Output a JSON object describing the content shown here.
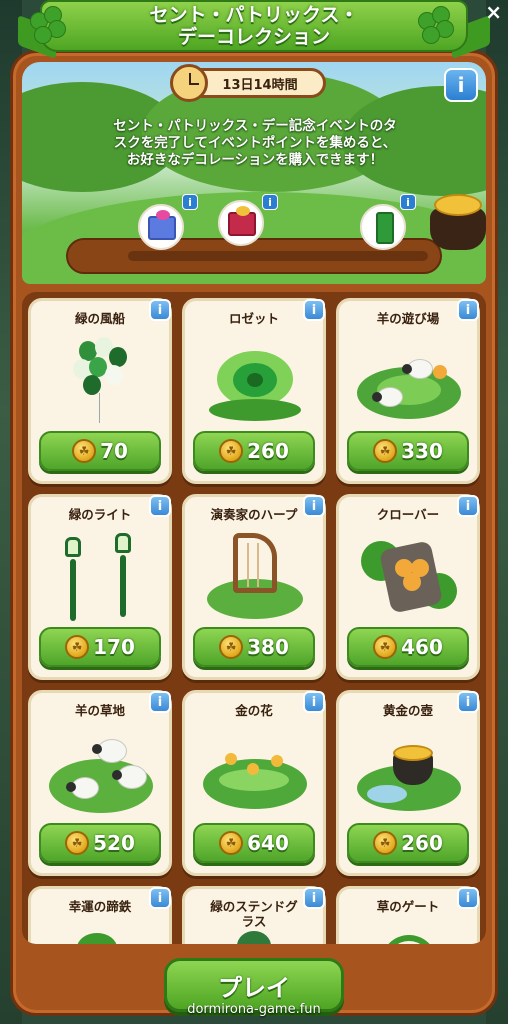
{
  "window": {
    "title": "セント・パトリックス・\nデーコレクション",
    "close_glyph": "×"
  },
  "event": {
    "timer": "13日14時間",
    "description": "セント・パトリックス・デー記念イベントのタ\nスクを完了してイベントポイントを集めると、\nお好きなデコレーションを購入できます！",
    "info_glyph": "i"
  },
  "rewards": [
    {
      "name": "gift-box-blue",
      "info": "i"
    },
    {
      "name": "gift-box-red",
      "info": "i"
    },
    {
      "name": "clover-card",
      "info": "i"
    }
  ],
  "items": [
    {
      "name": "緑の風船",
      "price": "70",
      "info": "i",
      "icon": "balloon-icon"
    },
    {
      "name": "ロゼット",
      "price": "260",
      "info": "i",
      "icon": "rosette-icon"
    },
    {
      "name": "羊の遊び場",
      "price": "330",
      "info": "i",
      "icon": "sheep-playground-icon"
    },
    {
      "name": "緑のライト",
      "price": "170",
      "info": "i",
      "icon": "lamp-icon"
    },
    {
      "name": "演奏家のハープ",
      "price": "380",
      "info": "i",
      "icon": "harp-icon"
    },
    {
      "name": "クローバー",
      "price": "460",
      "info": "i",
      "icon": "clover-statue-icon"
    },
    {
      "name": "羊の草地",
      "price": "520",
      "info": "i",
      "icon": "sheep-meadow-icon"
    },
    {
      "name": "金の花",
      "price": "640",
      "info": "i",
      "icon": "golden-flower-icon"
    },
    {
      "name": "黄金の壺",
      "price": "260",
      "info": "i",
      "icon": "gold-pot-icon"
    },
    {
      "name": "幸運の蹄鉄",
      "price": "",
      "info": "i",
      "icon": "horseshoe-icon"
    },
    {
      "name": "緑のステンドグ\nラス",
      "price": "",
      "info": "i",
      "icon": "stained-glass-icon"
    },
    {
      "name": "草のゲート",
      "price": "",
      "info": "i",
      "icon": "grass-gate-icon"
    }
  ],
  "play_button": {
    "label": "プレイ"
  },
  "watermark": "dormirona-game.fun",
  "colors": {
    "frame": "#a8541f",
    "button_green": "#4fa52a",
    "card_bg": "#fbf4e4",
    "info_blue": "#3a89d6",
    "coin_gold": "#e2a81c"
  }
}
